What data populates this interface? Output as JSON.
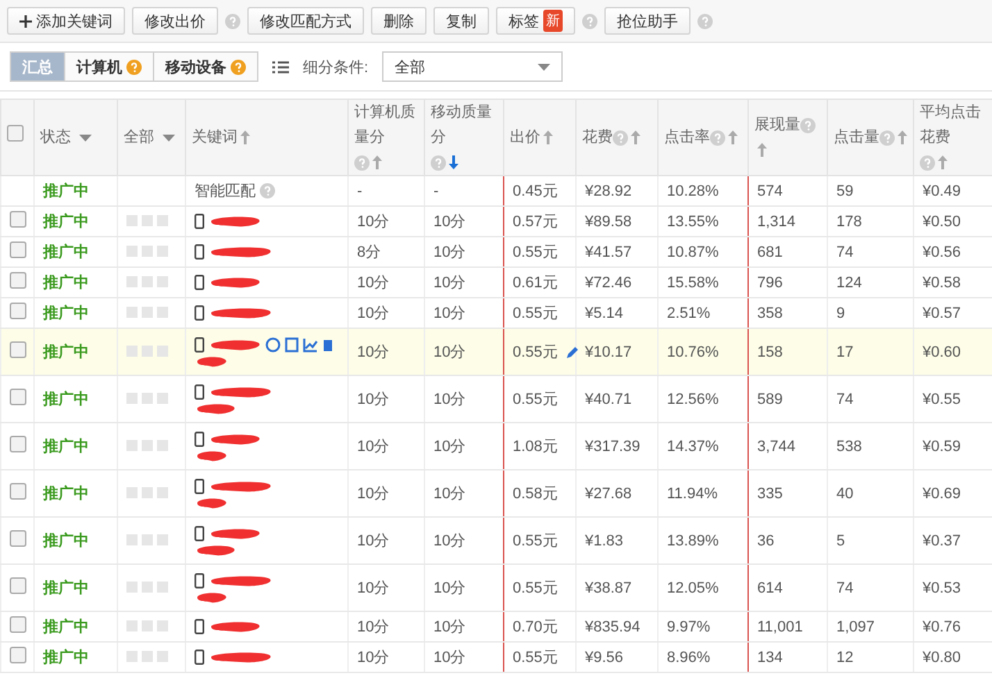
{
  "toolbar": [
    {
      "kind": "button",
      "label": "添加关键词",
      "plus": true
    },
    {
      "kind": "button",
      "label": "修改出价",
      "plus": false
    },
    {
      "kind": "help"
    },
    {
      "kind": "button",
      "label": "修改匹配方式",
      "plus": false
    },
    {
      "kind": "button",
      "label": "删除",
      "plus": false
    },
    {
      "kind": "button",
      "label": "复制",
      "plus": false
    },
    {
      "kind": "button",
      "label": "标签",
      "plus": false,
      "badge": "新"
    },
    {
      "kind": "help"
    },
    {
      "kind": "button",
      "label": "抢位助手",
      "plus": false
    },
    {
      "kind": "help"
    }
  ],
  "segments": [
    {
      "label": "汇总",
      "selected": true,
      "info": false
    },
    {
      "label": "计算机",
      "selected": false,
      "info": true
    },
    {
      "label": "移动设备",
      "selected": false,
      "info": true
    }
  ],
  "filter": {
    "label": "细分条件:",
    "value": "全部"
  },
  "table": {
    "header_checkbox": {
      "checked": false
    },
    "columns": [
      {
        "label": "状态",
        "dropdown": true,
        "help": false,
        "sortable": false,
        "highlighted": false
      },
      {
        "label": "全部",
        "dropdown": true,
        "help": false,
        "sortable": false,
        "highlighted": false
      },
      {
        "label": "关键词",
        "dropdown": false,
        "help": false,
        "sortable": true,
        "sort_descending": false,
        "highlighted": false
      },
      {
        "label": "计算机质量分",
        "dropdown": false,
        "help": true,
        "sortable": true,
        "sort_descending": false,
        "highlighted": true
      },
      {
        "label": "移动质量分",
        "dropdown": false,
        "help": true,
        "sortable": true,
        "sort_descending": true,
        "highlighted": true
      },
      {
        "label": "出价",
        "dropdown": false,
        "help": false,
        "sortable": true,
        "sort_descending": false,
        "highlighted": false
      },
      {
        "label": "花费",
        "dropdown": false,
        "help": true,
        "sortable": true,
        "sort_descending": false,
        "highlighted": false
      },
      {
        "label": "点击率",
        "dropdown": false,
        "help": true,
        "sortable": true,
        "sort_descending": false,
        "highlighted": true
      },
      {
        "label": "展现量",
        "dropdown": false,
        "help": true,
        "sortable": true,
        "sort_descending": false,
        "highlighted": false
      },
      {
        "label": "点击量",
        "dropdown": false,
        "help": true,
        "sortable": true,
        "sort_descending": false,
        "highlighted": false
      },
      {
        "label": "平均点击花费",
        "dropdown": false,
        "help": true,
        "sortable": true,
        "sort_descending": false,
        "highlighted": true
      }
    ],
    "rows": [
      {
        "kind": "smart",
        "status": "推广中",
        "keyword": "智能匹配",
        "pc_score": "-",
        "mobile_score": "-",
        "bid": "0.45元",
        "cost": "¥28.92",
        "ctr": "10.28%",
        "impressions": "574",
        "clicks": "59",
        "cpc": "¥0.49"
      },
      {
        "kind": "redacted",
        "checked": false,
        "tall": false,
        "hovered": false,
        "status": "推广中",
        "pc_score": "10分",
        "mobile_score": "10分",
        "bid": "0.57元",
        "cost": "¥89.58",
        "ctr": "13.55%",
        "impressions": "1,314",
        "clicks": "178",
        "cpc": "¥0.50"
      },
      {
        "kind": "redacted",
        "checked": false,
        "tall": false,
        "hovered": false,
        "status": "推广中",
        "pc_score": "8分",
        "mobile_score": "10分",
        "bid": "0.55元",
        "cost": "¥41.57",
        "ctr": "10.87%",
        "impressions": "681",
        "clicks": "74",
        "cpc": "¥0.56"
      },
      {
        "kind": "redacted",
        "checked": false,
        "tall": false,
        "hovered": false,
        "status": "推广中",
        "pc_score": "10分",
        "mobile_score": "10分",
        "bid": "0.61元",
        "cost": "¥72.46",
        "ctr": "15.58%",
        "impressions": "796",
        "clicks": "124",
        "cpc": "¥0.58"
      },
      {
        "kind": "redacted",
        "checked": false,
        "tall": false,
        "hovered": false,
        "status": "推广中",
        "pc_score": "10分",
        "mobile_score": "10分",
        "bid": "0.55元",
        "cost": "¥5.14",
        "ctr": "2.51%",
        "impressions": "358",
        "clicks": "9",
        "cpc": "¥0.57"
      },
      {
        "kind": "redacted",
        "checked": false,
        "tall": true,
        "hovered": true,
        "status": "推广中",
        "pc_score": "10分",
        "mobile_score": "10分",
        "bid": "0.55元",
        "cost": "¥10.17",
        "ctr": "10.76%",
        "impressions": "158",
        "clicks": "17",
        "cpc": "¥0.60"
      },
      {
        "kind": "redacted",
        "checked": false,
        "tall": true,
        "hovered": false,
        "status": "推广中",
        "pc_score": "10分",
        "mobile_score": "10分",
        "bid": "0.55元",
        "cost": "¥40.71",
        "ctr": "12.56%",
        "impressions": "589",
        "clicks": "74",
        "cpc": "¥0.55"
      },
      {
        "kind": "redacted",
        "checked": false,
        "tall": true,
        "hovered": false,
        "status": "推广中",
        "pc_score": "10分",
        "mobile_score": "10分",
        "bid": "1.08元",
        "cost": "¥317.39",
        "ctr": "14.37%",
        "impressions": "3,744",
        "clicks": "538",
        "cpc": "¥0.59"
      },
      {
        "kind": "redacted",
        "checked": false,
        "tall": true,
        "hovered": false,
        "status": "推广中",
        "pc_score": "10分",
        "mobile_score": "10分",
        "bid": "0.58元",
        "cost": "¥27.68",
        "ctr": "11.94%",
        "impressions": "335",
        "clicks": "40",
        "cpc": "¥0.69"
      },
      {
        "kind": "redacted",
        "checked": false,
        "tall": true,
        "hovered": false,
        "status": "推广中",
        "pc_score": "10分",
        "mobile_score": "10分",
        "bid": "0.55元",
        "cost": "¥1.83",
        "ctr": "13.89%",
        "impressions": "36",
        "clicks": "5",
        "cpc": "¥0.37"
      },
      {
        "kind": "redacted",
        "checked": false,
        "tall": true,
        "hovered": false,
        "status": "推广中",
        "pc_score": "10分",
        "mobile_score": "10分",
        "bid": "0.55元",
        "cost": "¥38.87",
        "ctr": "12.05%",
        "impressions": "614",
        "clicks": "74",
        "cpc": "¥0.53"
      },
      {
        "kind": "redacted",
        "checked": false,
        "tall": false,
        "hovered": false,
        "status": "推广中",
        "pc_score": "10分",
        "mobile_score": "10分",
        "bid": "0.70元",
        "cost": "¥835.94",
        "ctr": "9.97%",
        "impressions": "11,001",
        "clicks": "1,097",
        "cpc": "¥0.76"
      },
      {
        "kind": "redacted",
        "checked": false,
        "tall": false,
        "hovered": false,
        "status": "推广中",
        "pc_score": "10分",
        "mobile_score": "10分",
        "bid": "0.55元",
        "cost": "¥9.56",
        "ctr": "8.96%",
        "impressions": "134",
        "clicks": "12",
        "cpc": "¥0.80"
      }
    ]
  }
}
